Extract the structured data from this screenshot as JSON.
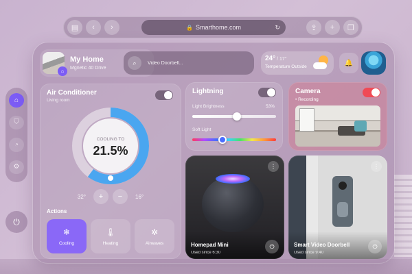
{
  "browser": {
    "url": "Smarthome.com",
    "icons": [
      "sidebar-icon",
      "back-icon",
      "forward-icon",
      "lock-icon",
      "reload-icon",
      "share-icon",
      "add-tab-icon",
      "tabs-icon"
    ]
  },
  "dock": {
    "items": [
      "home-icon",
      "shield-icon",
      "chart-icon",
      "settings-icon"
    ],
    "power_icon": "power-icon"
  },
  "header": {
    "home_title": "My Home",
    "home_subtitle": "Mgnetic 40 Drive",
    "search_text": "Video Doorbell...",
    "temperature": "24°",
    "temperature_low": " / 17°",
    "temperature_label": "Temperature Outside",
    "weather_icon": "partly-cloudy-icon",
    "notification_icon": "bell-icon"
  },
  "ac": {
    "title": "Air Conditioner",
    "room": "Living room",
    "toggle_on": true,
    "dial_label": "COOLING TO",
    "dial_value": "21.5%",
    "dial_fraction": 0.6,
    "temp_left": "32°",
    "temp_right": "16°",
    "plus": "+",
    "minus": "−",
    "actions_label": "Actions",
    "actions": [
      {
        "label": "Cooling",
        "icon": "snowflake-icon",
        "glyph": "❄"
      },
      {
        "label": "Heating",
        "icon": "thermometer-icon",
        "glyph": "🌡"
      },
      {
        "label": "Airwaves",
        "icon": "fan-icon",
        "glyph": "✲"
      }
    ]
  },
  "lighting": {
    "title": "Lightning",
    "toggle_on": true,
    "brightness_label": "Light Brightness",
    "brightness_value": "53%",
    "brightness_fraction": 0.53,
    "soft_label": "Soft Light",
    "color_fraction": 0.36
  },
  "camera": {
    "title": "Camera",
    "status": "• Recording",
    "toggle_on": true,
    "toggle_color": "#f04a55"
  },
  "devices": [
    {
      "name": "Homepad Mini",
      "sub": "Used since 6:30"
    },
    {
      "name": "Smart Video Doorbell",
      "sub": "Used since 9:40"
    }
  ],
  "colors": {
    "accent": "#8a68f7",
    "dial_blue": "#4aa6f0",
    "recording_red": "#f04a55"
  }
}
